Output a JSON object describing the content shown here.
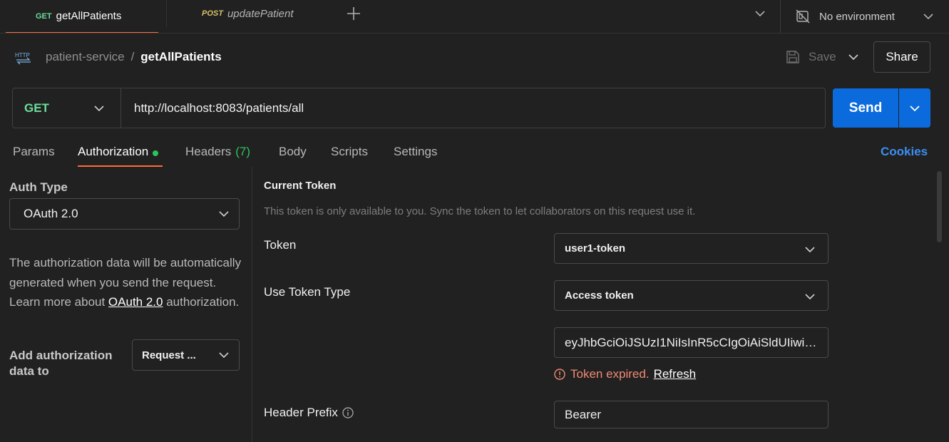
{
  "tabs": [
    {
      "method": "GET",
      "name": "getAllPatients"
    },
    {
      "method": "POST",
      "name": "updatePatient"
    }
  ],
  "environment": {
    "label": "No environment"
  },
  "breadcrumb": {
    "parent": "patient-service",
    "separator": "/",
    "current": "getAllPatients"
  },
  "toolbar": {
    "save_label": "Save",
    "share_label": "Share"
  },
  "request": {
    "method": "GET",
    "url": "http://localhost:8083/patients/all",
    "send_label": "Send"
  },
  "request_tabs": {
    "params": "Params",
    "authorization": "Authorization",
    "headers": "Headers",
    "headers_count": "(7)",
    "body": "Body",
    "scripts": "Scripts",
    "settings": "Settings",
    "cookies": "Cookies"
  },
  "auth": {
    "type_label": "Auth Type",
    "type_value": "OAuth 2.0",
    "desc_before": "The authorization data will be automatically generated when you send the request. Learn more about ",
    "desc_link": "OAuth 2.0",
    "desc_after": " authorization.",
    "add_to_label": "Add authorization data to",
    "add_to_value": "Request ..."
  },
  "current_token": {
    "title": "Current Token",
    "description": "This token is only available to you. Sync the token to let collaborators on this request use it.",
    "token_label": "Token",
    "token_value": "user1-token",
    "use_token_type_label": "Use Token Type",
    "use_token_type_value": "Access token",
    "token_string": "eyJhbGciOiJSUzI1NiIsInR5cCIgOiAiSldUIiwia...",
    "expired_text": "Token expired.",
    "refresh_label": "Refresh",
    "header_prefix_label": "Header Prefix",
    "header_prefix_value": "Bearer"
  },
  "colors": {
    "get": "#6bdd9a",
    "post": "#d6c06a",
    "accent": "#ff6c37",
    "send": "#0c6bdc",
    "cookies": "#3b8ff2",
    "status_ok": "#2bc45a",
    "error": "#f08a73"
  },
  "icons": [
    "plus-icon",
    "chevron-down-icon",
    "no-environment-icon",
    "http-icon",
    "save-icon",
    "alert-circle-icon",
    "info-icon"
  ]
}
